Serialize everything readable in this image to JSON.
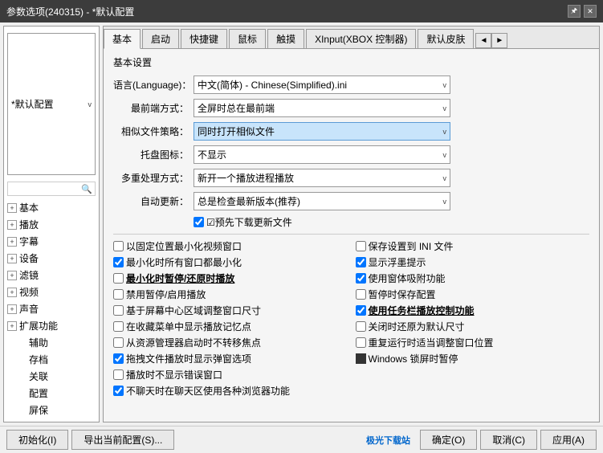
{
  "window": {
    "title": "参数选项(240315) - *默认配置",
    "title_controls": [
      "pin",
      "close"
    ]
  },
  "sidebar": {
    "search_placeholder": "",
    "items": [
      {
        "id": "basic",
        "label": "基本",
        "expanded": false,
        "has_children": true
      },
      {
        "id": "play",
        "label": "播放",
        "expanded": false,
        "has_children": true
      },
      {
        "id": "subtitle",
        "label": "字幕",
        "expanded": false,
        "has_children": true
      },
      {
        "id": "device",
        "label": "设备",
        "expanded": false,
        "has_children": true
      },
      {
        "id": "filter",
        "label": "滤镜",
        "expanded": false,
        "has_children": true
      },
      {
        "id": "video",
        "label": "视频",
        "expanded": false,
        "has_children": true
      },
      {
        "id": "audio",
        "label": "声音",
        "expanded": false,
        "has_children": true
      },
      {
        "id": "extend",
        "label": "扩展功能",
        "expanded": false,
        "has_children": true
      },
      {
        "id": "assist",
        "label": "辅助",
        "expanded": false,
        "has_children": false
      },
      {
        "id": "save",
        "label": "存档",
        "expanded": false,
        "has_children": false
      },
      {
        "id": "relate",
        "label": "关联",
        "expanded": false,
        "has_children": false
      },
      {
        "id": "config",
        "label": "配置",
        "expanded": false,
        "has_children": false
      },
      {
        "id": "screensave",
        "label": "屏保",
        "expanded": false,
        "has_children": false
      }
    ]
  },
  "profile_selector": {
    "value": "*默认配置",
    "arrow": "v"
  },
  "tabs": {
    "items": [
      {
        "id": "basic",
        "label": "基本",
        "active": true
      },
      {
        "id": "start",
        "label": "启动"
      },
      {
        "id": "shortcut",
        "label": "快捷键"
      },
      {
        "id": "mouse",
        "label": "鼠标"
      },
      {
        "id": "touch",
        "label": "触摸"
      },
      {
        "id": "xinput",
        "label": "XInput(XBOX 控制器)"
      },
      {
        "id": "skin",
        "label": "默认皮肤"
      },
      {
        "id": "more1",
        "label": "◄"
      },
      {
        "id": "more2",
        "label": "►"
      }
    ]
  },
  "panel": {
    "section_title": "基本设置",
    "form_rows": [
      {
        "label": "语言(Language)：",
        "value": "中文(简体) - Chinese(Simplified).ini",
        "highlight": false
      },
      {
        "label": "最前端方式：",
        "value": "全屏时总在最前端",
        "highlight": false
      },
      {
        "label": "相似文件策略：",
        "value": "同时打开相似文件",
        "highlight": true
      },
      {
        "label": "托盘图标：",
        "value": "不显示",
        "highlight": false
      },
      {
        "label": "多重处理方式：",
        "value": "新开一个播放进程播放",
        "highlight": false
      },
      {
        "label": "自动更新：",
        "value": "总是检查最新版本(推荐)",
        "highlight": false
      }
    ],
    "predownload": {
      "label": "☑预先下载更新文件"
    },
    "checkboxes": [
      {
        "id": "fix_pos",
        "label": "以固定位置最小化视频窗口",
        "checked": false,
        "bold": false
      },
      {
        "id": "save_ini",
        "label": "保存设置到 INI 文件",
        "checked": false,
        "bold": false
      },
      {
        "id": "min_all",
        "label": "最小化时所有窗口都最小化",
        "checked": true,
        "bold": false
      },
      {
        "id": "show_float",
        "label": "显示浮墨提示",
        "checked": true,
        "bold": false
      },
      {
        "id": "min_pause",
        "label": "最小化时暂停/还原时播放",
        "checked": false,
        "bold": true,
        "underline": true
      },
      {
        "id": "window_absorb",
        "label": "使用窗体吸附功能",
        "checked": true,
        "bold": false
      },
      {
        "id": "disable_pause",
        "label": "禁用暂停/启用播放",
        "checked": false,
        "bold": false
      },
      {
        "id": "pause_save",
        "label": "暂停时保存配置",
        "checked": false,
        "bold": false
      },
      {
        "id": "center_resize",
        "label": "基于屏幕中心区域调整窗口尺寸",
        "checked": false,
        "bold": false
      },
      {
        "id": "taskbar_play",
        "label": "使用任务栏播放控制功能",
        "checked": true,
        "bold": true,
        "underline": true
      },
      {
        "id": "show_history",
        "label": "在收藏菜单中显示播放记忆点",
        "checked": false,
        "bold": false
      },
      {
        "id": "restore_default",
        "label": "关闭时还原为默认尺寸",
        "checked": false,
        "bold": false
      },
      {
        "id": "no_focus",
        "label": "从资源管理器启动时不转移焦点",
        "checked": false,
        "bold": false
      },
      {
        "id": "readjust",
        "label": "重复运行时适当调整窗口位置",
        "checked": false,
        "bold": false
      },
      {
        "id": "drag_show",
        "label": "拖拽文件播放时显示弹窗选项",
        "checked": true,
        "bold": false
      },
      {
        "id": "win_lock_pause",
        "label": "Windows 锁屏时暂停",
        "checked": false,
        "bold": false,
        "square_checkbox": true
      },
      {
        "id": "no_error",
        "label": "播放时不显示错误窗口",
        "checked": false,
        "bold": false
      },
      {
        "id": "browser_func",
        "label": "不聊天时在聊天区使用各种浏览器功能",
        "checked": true,
        "bold": false
      }
    ]
  },
  "bottom": {
    "left_buttons": [
      {
        "id": "init",
        "label": "初始化(I)"
      },
      {
        "id": "export",
        "label": "导出当前配置(S)..."
      }
    ],
    "right_buttons": [
      {
        "id": "ok",
        "label": "确定(O)"
      },
      {
        "id": "cancel",
        "label": "取消(C)"
      },
      {
        "id": "apply",
        "label": "应用(A)"
      }
    ]
  }
}
